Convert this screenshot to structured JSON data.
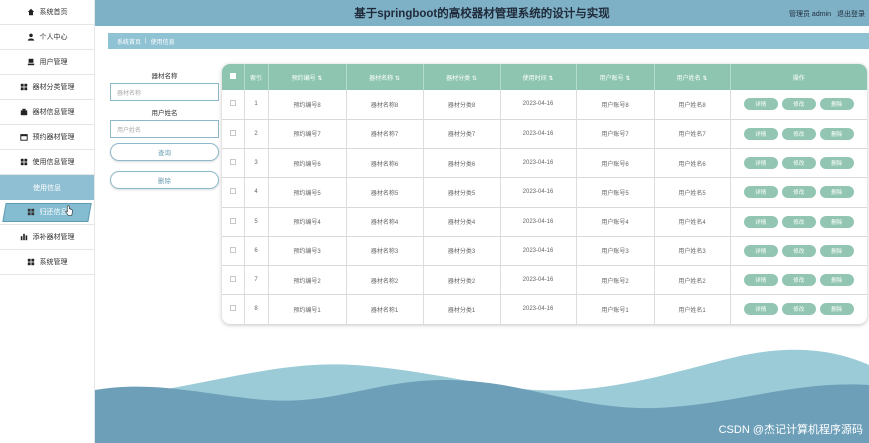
{
  "sidebar": {
    "items": [
      {
        "label": "系统首页",
        "icon": "home-icon"
      },
      {
        "label": "个人中心",
        "icon": "user-icon"
      },
      {
        "label": "用户管理",
        "icon": "users-icon"
      },
      {
        "label": "器材分类管理",
        "icon": "grid-icon"
      },
      {
        "label": "器材信息管理",
        "icon": "grid-icon"
      },
      {
        "label": "预约器材管理",
        "icon": "grid-icon"
      },
      {
        "label": "使用信息管理",
        "icon": "grid-icon"
      },
      {
        "label": "使用信息",
        "icon": "",
        "sub": true
      },
      {
        "label": "归还信息",
        "icon": "grid-icon",
        "active": true
      },
      {
        "label": "添补器材管理",
        "icon": "bar-chart-icon"
      },
      {
        "label": "系统管理",
        "icon": "grid-icon"
      }
    ]
  },
  "header": {
    "title": "基于springboot的高校器材管理系统的设计与实现",
    "user": "管理员 admin",
    "logout": "退出登录"
  },
  "breadcrumb": {
    "home": "系统首页",
    "sep": "|",
    "current": "使用信息"
  },
  "search": {
    "equipment_label": "器材名称",
    "equipment_placeholder": "器材名称",
    "username_label": "用户姓名",
    "username_placeholder": "用户姓名",
    "query_button": "查询",
    "delete_button": "删除"
  },
  "table": {
    "headers": [
      "索引",
      "预约编号",
      "器材名称",
      "器材分类",
      "使用时间",
      "用户账号",
      "用户姓名",
      "操作"
    ],
    "actions": [
      "详情",
      "修改",
      "删除"
    ],
    "rows": [
      {
        "index": "1",
        "booking": "预约编号8",
        "name": "器材名称8",
        "category": "器材分类8",
        "time": "2023-04-16",
        "account": "用户账号8",
        "username": "用户姓名8"
      },
      {
        "index": "2",
        "booking": "预约编号7",
        "name": "器材名称7",
        "category": "器材分类7",
        "time": "2023-04-16",
        "account": "用户账号7",
        "username": "用户姓名7"
      },
      {
        "index": "3",
        "booking": "预约编号6",
        "name": "器材名称6",
        "category": "器材分类6",
        "time": "2023-04-16",
        "account": "用户账号6",
        "username": "用户姓名6"
      },
      {
        "index": "4",
        "booking": "预约编号5",
        "name": "器材名称5",
        "category": "器材分类5",
        "time": "2023-04-16",
        "account": "用户账号5",
        "username": "用户姓名5"
      },
      {
        "index": "5",
        "booking": "预约编号4",
        "name": "器材名称4",
        "category": "器材分类4",
        "time": "2023-04-16",
        "account": "用户账号4",
        "username": "用户姓名4"
      },
      {
        "index": "6",
        "booking": "预约编号3",
        "name": "器材名称3",
        "category": "器材分类3",
        "time": "2023-04-16",
        "account": "用户账号3",
        "username": "用户姓名3"
      },
      {
        "index": "7",
        "booking": "预约编号2",
        "name": "器材名称2",
        "category": "器材分类2",
        "time": "2023-04-16",
        "account": "用户账号2",
        "username": "用户姓名2"
      },
      {
        "index": "8",
        "booking": "预约编号1",
        "name": "器材名称1",
        "category": "器材分类1",
        "time": "2023-04-16",
        "account": "用户账号1",
        "username": "用户姓名1"
      }
    ]
  },
  "watermark": "CSDN @杰记计算机程序源码",
  "colors": {
    "header_bg": "#7fb1c6",
    "table_header_bg": "#8ec5b1",
    "action_button_bg": "#92c6b2",
    "sidebar_active_bg": "#84bdd1",
    "wave_dark": "#6d9fb8",
    "wave_light": "#9bcbd7"
  }
}
